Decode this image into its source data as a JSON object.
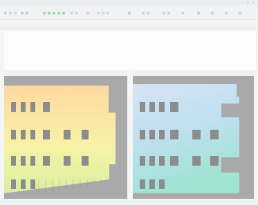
{
  "window": {
    "title": ""
  },
  "tabs": [],
  "console": {
    "lines": []
  },
  "panels": {
    "left_title": "",
    "right_title": ""
  },
  "status": {
    "text": ""
  },
  "icons": [
    "minimize-icon",
    "maximize-icon",
    "close-icon"
  ],
  "colors": {
    "viewport_bg": "#a9a9a9",
    "left_model_top": "#ffd9a0",
    "left_model_bottom": "#d9f0a2",
    "right_model_top": "#cfe6f5",
    "right_model_bottom": "#9fe3d3",
    "window_opening": "#8c8c8c"
  }
}
